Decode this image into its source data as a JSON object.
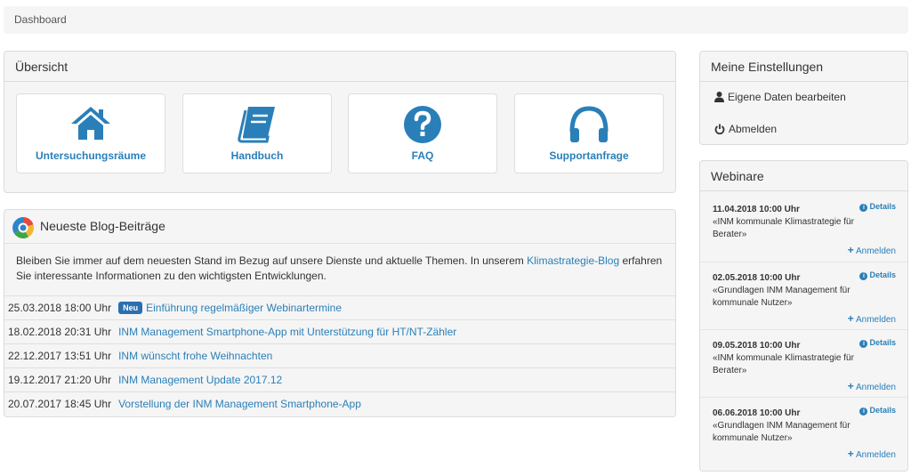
{
  "breadcrumb": {
    "label": "Dashboard"
  },
  "overview": {
    "title": "Übersicht",
    "tiles": [
      {
        "label": "Untersuchungsräume",
        "icon": "home-icon"
      },
      {
        "label": "Handbuch",
        "icon": "book-icon"
      },
      {
        "label": "FAQ",
        "icon": "question-icon"
      },
      {
        "label": "Supportanfrage",
        "icon": "headphones-icon"
      }
    ]
  },
  "blog": {
    "title": "Neueste Blog-Beiträge",
    "intro_before": "Bleiben Sie immer auf dem neuesten Stand im Bezug auf unsere Dienste und aktuelle Themen. In unserem ",
    "intro_link": "Klimastrategie-Blog",
    "intro_after": " erfahren Sie interessante Informationen zu den wichtigsten Entwicklungen.",
    "new_badge": "Neu",
    "posts": [
      {
        "date": "25.03.2018 18:00 Uhr",
        "title": "Einführung regelmäßiger Webinartermine"
      },
      {
        "date": "18.02.2018 20:31 Uhr",
        "title": "INM Management Smartphone-App mit Unterstützung für HT/NT-Zähler"
      },
      {
        "date": "22.12.2017 13:51 Uhr",
        "title": "INM wünscht frohe Weihnachten"
      },
      {
        "date": "19.12.2017 21:20 Uhr",
        "title": "INM Management Update 2017.12"
      },
      {
        "date": "20.07.2017 18:45 Uhr",
        "title": "Vorstellung der INM Management Smartphone-App"
      }
    ]
  },
  "settings": {
    "title": "Meine Einstellungen",
    "edit_label": "Eigene Daten bearbeiten",
    "logout_label": "Abmelden"
  },
  "webinars": {
    "title": "Webinare",
    "details_label": "Details",
    "register_label": "Anmelden",
    "items": [
      {
        "date": "11.04.2018 10:00 Uhr",
        "title": "«INM kommunale Klimastrategie für Berater»"
      },
      {
        "date": "02.05.2018 10:00 Uhr",
        "title": "«Grundlagen INM Management für kommunale Nutzer»"
      },
      {
        "date": "09.05.2018 10:00 Uhr",
        "title": "«INM kommunale Klimastrategie für Berater»"
      },
      {
        "date": "06.06.2018 10:00 Uhr",
        "title": "«Grundlagen INM Management für kommunale Nutzer»"
      }
    ]
  },
  "colors": {
    "accent": "#2a7fb8",
    "badge": "#2a6fb0",
    "panel": "#f5f5f5"
  }
}
